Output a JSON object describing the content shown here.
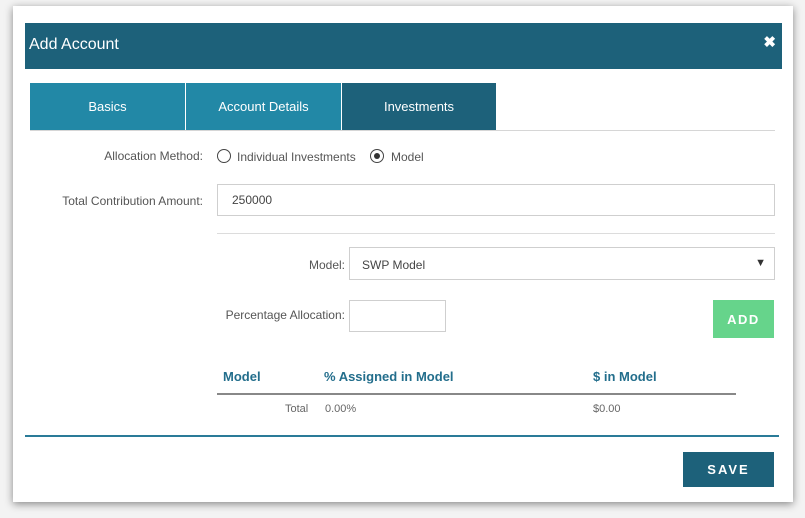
{
  "dialog": {
    "title": "Add Account",
    "close_icon": "close-icon",
    "close_glyph": "✖"
  },
  "tabs": [
    {
      "label": "Basics",
      "active": false
    },
    {
      "label": "Account Details",
      "active": false
    },
    {
      "label": "Investments",
      "active": true
    }
  ],
  "allocation": {
    "label": "Allocation Method:",
    "options": [
      {
        "label": "Individual Investments",
        "selected": false
      },
      {
        "label": "Model",
        "selected": true
      }
    ]
  },
  "contribution": {
    "label": "Total Contribution Amount:",
    "value": "250000"
  },
  "model": {
    "label": "Model:",
    "selected": "SWP Model",
    "caret": "▼"
  },
  "percentage": {
    "label": "Percentage Allocation:",
    "value": ""
  },
  "add_button": "ADD",
  "table": {
    "headers": [
      "Model",
      "% Assigned in Model",
      "$ in Model"
    ],
    "total_label": "Total",
    "total_percent": "0.00%",
    "total_amount": "$0.00"
  },
  "save_button": "SAVE",
  "colors": {
    "header": "#1d617a",
    "tab": "#2288a6",
    "tab_active": "#1d617a",
    "add": "#66d48b",
    "table_header_text": "#236e8c"
  }
}
